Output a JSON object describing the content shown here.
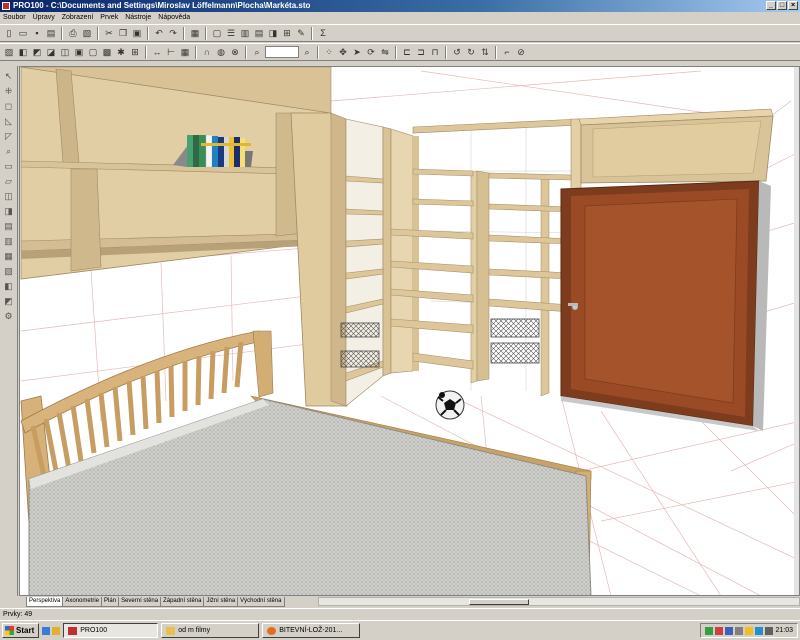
{
  "window": {
    "title": "PRO100 - C:\\Documents and Settings\\Miroslav Löffelmann\\Plocha\\Markéta.sto"
  },
  "menu": [
    "Soubor",
    "Úpravy",
    "Zobrazení",
    "Prvek",
    "Nástroje",
    "Nápověda"
  ],
  "view_tabs": [
    "Perspektiva",
    "Axonometrie",
    "Plán",
    "Severní stěna",
    "Západní stěna",
    "Jižní stěna",
    "Východní stěna"
  ],
  "status": {
    "items_label": "Prvky: 49"
  },
  "taskbar": {
    "start_label": "Start",
    "items": [
      "PRO100",
      "od m filmy",
      "BITEVNÍ-LOŽ-201..."
    ],
    "clock": "21:03"
  },
  "colors": {
    "wood_light": "#ddc79b",
    "door": "#9a4a25",
    "titlebar": "#0a246a",
    "mattress": "#c8c8c4"
  }
}
